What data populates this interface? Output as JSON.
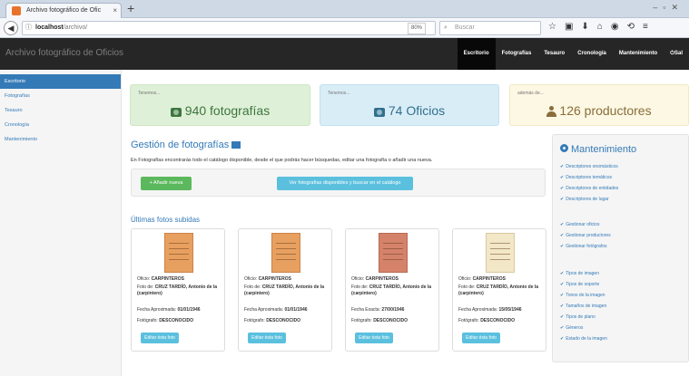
{
  "browser": {
    "tab_title": "Archivo fotográfico de Ofic",
    "tab_close": "×",
    "new_tab": "+",
    "url_host": "localhost",
    "url_path": "/archivo/",
    "zoom": "80%",
    "search_placeholder": "Buscar"
  },
  "app": {
    "brand": "Archivo fotográfico de Oficios",
    "menu": [
      "Escritorio",
      "Fotografías",
      "Tesauro",
      "Cronología",
      "Mantenimiento",
      "Sal"
    ]
  },
  "sidebar": {
    "items": [
      "Escritorio",
      "Fotografías",
      "Tesauro",
      "Cronología",
      "Mantenimiento"
    ]
  },
  "stats": [
    {
      "small": "Tenemos...",
      "big": "940 fotografías",
      "icon": "camera-icon"
    },
    {
      "small": "Tenemos...",
      "big": "74 Oficios",
      "icon": "camera-icon"
    },
    {
      "small": "además de...",
      "big": "126 productores",
      "icon": "user-icon"
    }
  ],
  "gestion": {
    "title": "Gestión de fotografías",
    "description": "En Fotografías encontrarás todo el catálogo disponible, desde el que podrás hacer búsquedas, editar una fotografía o añadir una nueva.",
    "add_button": "+ Añadir nueva",
    "see_button": "Ver fotografías disponibles y buscar en el catálogo"
  },
  "latest": {
    "title": "Últimas fotos subidas",
    "cards": [
      {
        "oficio_label": "Oficio:",
        "oficio": "CARPINTEROS",
        "foto_label": "Foto de:",
        "foto": "CRUZ TARDÍO, Antonio de la (carpintero)",
        "fecha_label": "Fecha Aproximada:",
        "fecha": "01/01/1946",
        "fotografo_label": "Fotógrafo:",
        "fotografo": "DESCONOCIDO",
        "button": "Editar ésta foto"
      },
      {
        "oficio_label": "Oficio:",
        "oficio": "CARPINTEROS",
        "foto_label": "Foto de:",
        "foto": "CRUZ TARDÍO, Antonio de la (carpintero)",
        "fecha_label": "Fecha Aproximada:",
        "fecha": "01/01/1946",
        "fotografo_label": "Fotógrafo:",
        "fotografo": "DESCONOCIDO",
        "button": "Editar ésta foto"
      },
      {
        "oficio_label": "Oficio:",
        "oficio": "CARPINTEROS",
        "foto_label": "Foto de:",
        "foto": "CRUZ TARDÍO, Antonio de la (carpintero)",
        "fecha_label": "Fecha Exacta:",
        "fecha": "27/00/1946",
        "fotografo_label": "Fotógrafo:",
        "fotografo": "DESCONOCIDO",
        "button": "Editar ésta foto"
      },
      {
        "oficio_label": "Oficio:",
        "oficio": "CARPINTEROS",
        "foto_label": "Foto de:",
        "foto": "CRUZ TARDÍO, Antonio de la (carpintero)",
        "fecha_label": "Fecha Aproximada:",
        "fecha": "15/05/1946",
        "fotografo_label": "Fotógrafo:",
        "fotografo": "DESCONOCIDO",
        "button": "Editar ésta foto"
      }
    ]
  },
  "mantenimiento": {
    "title": "Mantenimiento",
    "links": [
      "Descriptores onomásticos",
      "Descriptores temáticos",
      "Descriptores de entidades",
      "Descriptores de lugar",
      "Gestionar oficios",
      "Gestionar productores",
      "Gestionar fotógrafos",
      "Tipos de imagen",
      "Tipos de soporte",
      "Tonos de la imagen",
      "Tamaños de imagen",
      "Tipos de plano",
      "Géneros",
      "Estado de la imagen"
    ]
  },
  "colors": {
    "primary": "#337ab7",
    "success": "#5cb85c",
    "info": "#5bc0de",
    "navbar": "#262626"
  }
}
